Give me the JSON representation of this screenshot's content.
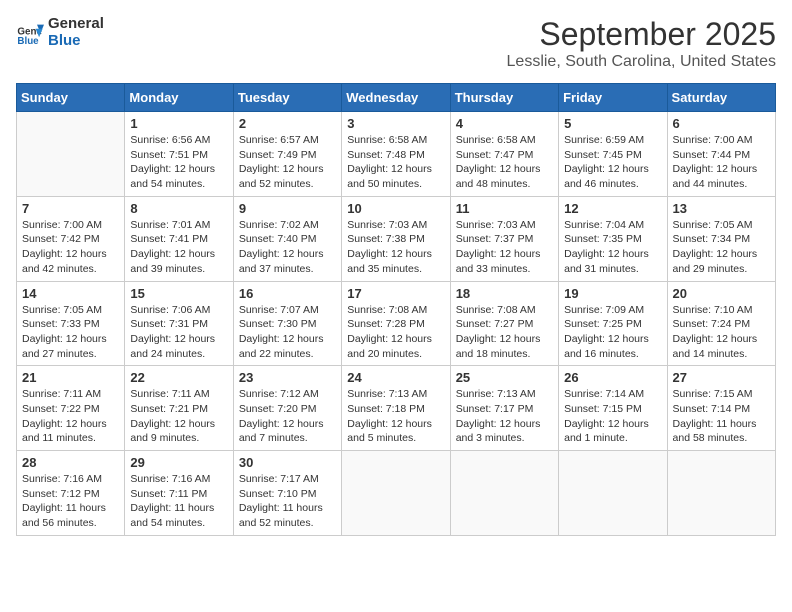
{
  "header": {
    "logo_general": "General",
    "logo_blue": "Blue",
    "month_year": "September 2025",
    "location": "Lesslie, South Carolina, United States"
  },
  "calendar": {
    "weekdays": [
      "Sunday",
      "Monday",
      "Tuesday",
      "Wednesday",
      "Thursday",
      "Friday",
      "Saturday"
    ],
    "weeks": [
      [
        {
          "day": "",
          "info": ""
        },
        {
          "day": "1",
          "info": "Sunrise: 6:56 AM\nSunset: 7:51 PM\nDaylight: 12 hours\nand 54 minutes."
        },
        {
          "day": "2",
          "info": "Sunrise: 6:57 AM\nSunset: 7:49 PM\nDaylight: 12 hours\nand 52 minutes."
        },
        {
          "day": "3",
          "info": "Sunrise: 6:58 AM\nSunset: 7:48 PM\nDaylight: 12 hours\nand 50 minutes."
        },
        {
          "day": "4",
          "info": "Sunrise: 6:58 AM\nSunset: 7:47 PM\nDaylight: 12 hours\nand 48 minutes."
        },
        {
          "day": "5",
          "info": "Sunrise: 6:59 AM\nSunset: 7:45 PM\nDaylight: 12 hours\nand 46 minutes."
        },
        {
          "day": "6",
          "info": "Sunrise: 7:00 AM\nSunset: 7:44 PM\nDaylight: 12 hours\nand 44 minutes."
        }
      ],
      [
        {
          "day": "7",
          "info": "Sunrise: 7:00 AM\nSunset: 7:42 PM\nDaylight: 12 hours\nand 42 minutes."
        },
        {
          "day": "8",
          "info": "Sunrise: 7:01 AM\nSunset: 7:41 PM\nDaylight: 12 hours\nand 39 minutes."
        },
        {
          "day": "9",
          "info": "Sunrise: 7:02 AM\nSunset: 7:40 PM\nDaylight: 12 hours\nand 37 minutes."
        },
        {
          "day": "10",
          "info": "Sunrise: 7:03 AM\nSunset: 7:38 PM\nDaylight: 12 hours\nand 35 minutes."
        },
        {
          "day": "11",
          "info": "Sunrise: 7:03 AM\nSunset: 7:37 PM\nDaylight: 12 hours\nand 33 minutes."
        },
        {
          "day": "12",
          "info": "Sunrise: 7:04 AM\nSunset: 7:35 PM\nDaylight: 12 hours\nand 31 minutes."
        },
        {
          "day": "13",
          "info": "Sunrise: 7:05 AM\nSunset: 7:34 PM\nDaylight: 12 hours\nand 29 minutes."
        }
      ],
      [
        {
          "day": "14",
          "info": "Sunrise: 7:05 AM\nSunset: 7:33 PM\nDaylight: 12 hours\nand 27 minutes."
        },
        {
          "day": "15",
          "info": "Sunrise: 7:06 AM\nSunset: 7:31 PM\nDaylight: 12 hours\nand 24 minutes."
        },
        {
          "day": "16",
          "info": "Sunrise: 7:07 AM\nSunset: 7:30 PM\nDaylight: 12 hours\nand 22 minutes."
        },
        {
          "day": "17",
          "info": "Sunrise: 7:08 AM\nSunset: 7:28 PM\nDaylight: 12 hours\nand 20 minutes."
        },
        {
          "day": "18",
          "info": "Sunrise: 7:08 AM\nSunset: 7:27 PM\nDaylight: 12 hours\nand 18 minutes."
        },
        {
          "day": "19",
          "info": "Sunrise: 7:09 AM\nSunset: 7:25 PM\nDaylight: 12 hours\nand 16 minutes."
        },
        {
          "day": "20",
          "info": "Sunrise: 7:10 AM\nSunset: 7:24 PM\nDaylight: 12 hours\nand 14 minutes."
        }
      ],
      [
        {
          "day": "21",
          "info": "Sunrise: 7:11 AM\nSunset: 7:22 PM\nDaylight: 12 hours\nand 11 minutes."
        },
        {
          "day": "22",
          "info": "Sunrise: 7:11 AM\nSunset: 7:21 PM\nDaylight: 12 hours\nand 9 minutes."
        },
        {
          "day": "23",
          "info": "Sunrise: 7:12 AM\nSunset: 7:20 PM\nDaylight: 12 hours\nand 7 minutes."
        },
        {
          "day": "24",
          "info": "Sunrise: 7:13 AM\nSunset: 7:18 PM\nDaylight: 12 hours\nand 5 minutes."
        },
        {
          "day": "25",
          "info": "Sunrise: 7:13 AM\nSunset: 7:17 PM\nDaylight: 12 hours\nand 3 minutes."
        },
        {
          "day": "26",
          "info": "Sunrise: 7:14 AM\nSunset: 7:15 PM\nDaylight: 12 hours\nand 1 minute."
        },
        {
          "day": "27",
          "info": "Sunrise: 7:15 AM\nSunset: 7:14 PM\nDaylight: 11 hours\nand 58 minutes."
        }
      ],
      [
        {
          "day": "28",
          "info": "Sunrise: 7:16 AM\nSunset: 7:12 PM\nDaylight: 11 hours\nand 56 minutes."
        },
        {
          "day": "29",
          "info": "Sunrise: 7:16 AM\nSunset: 7:11 PM\nDaylight: 11 hours\nand 54 minutes."
        },
        {
          "day": "30",
          "info": "Sunrise: 7:17 AM\nSunset: 7:10 PM\nDaylight: 11 hours\nand 52 minutes."
        },
        {
          "day": "",
          "info": ""
        },
        {
          "day": "",
          "info": ""
        },
        {
          "day": "",
          "info": ""
        },
        {
          "day": "",
          "info": ""
        }
      ]
    ]
  }
}
